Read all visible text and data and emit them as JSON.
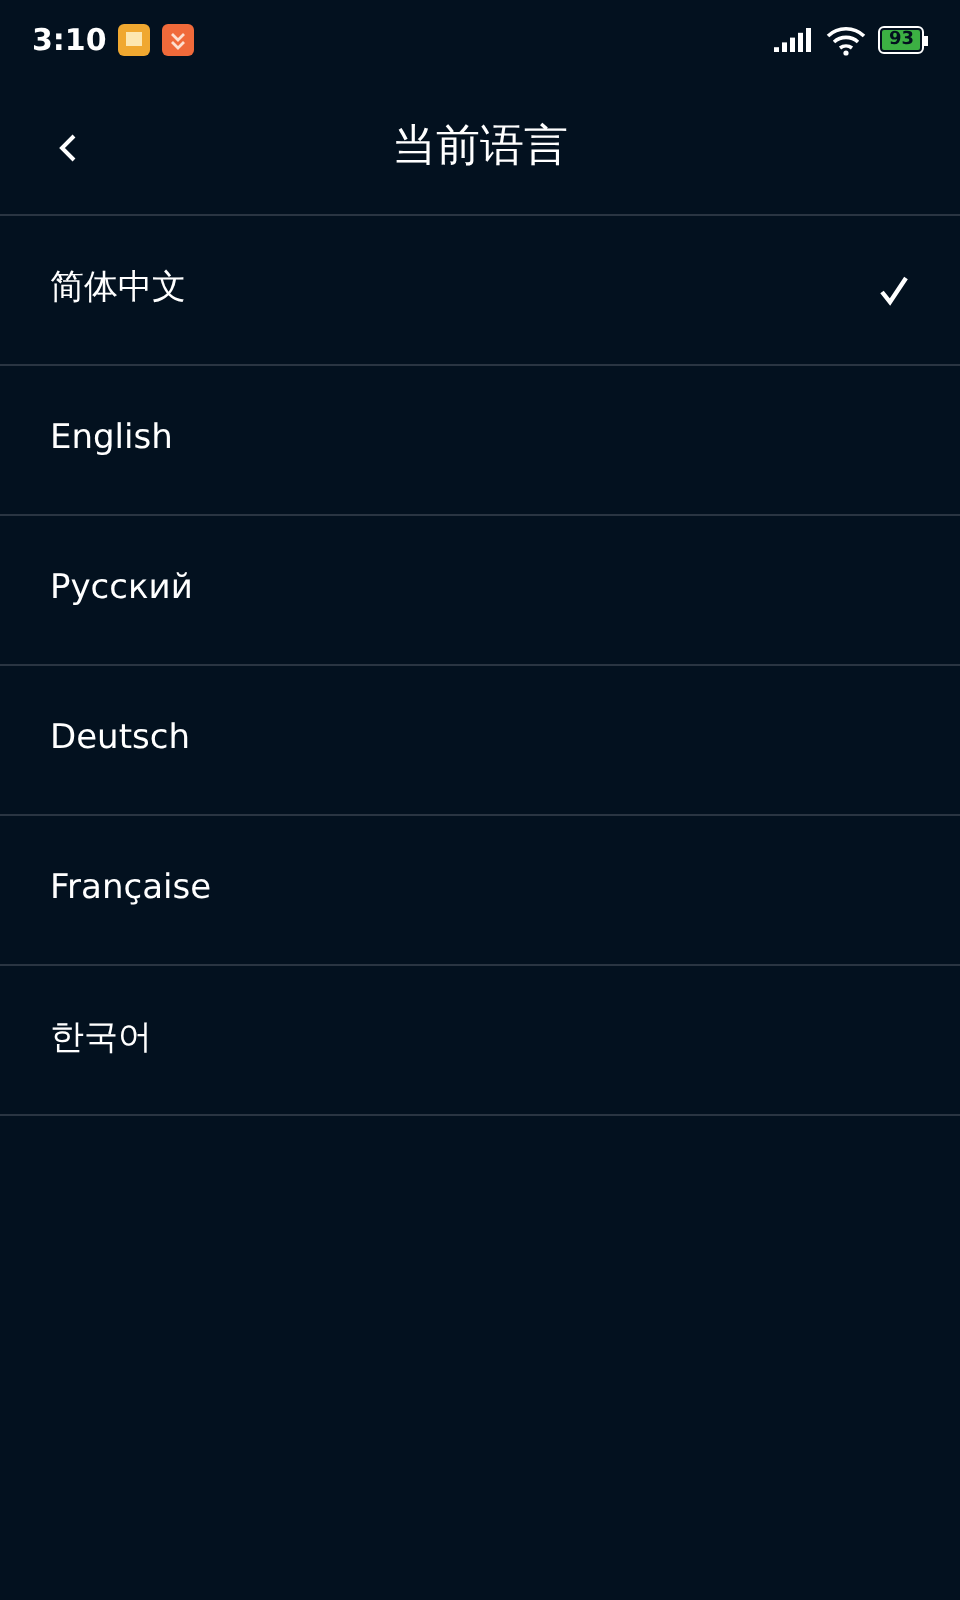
{
  "status_bar": {
    "time": "3:10",
    "battery": "93"
  },
  "header": {
    "title": "当前语言"
  },
  "languages": [
    {
      "label": "简体中文",
      "selected": true
    },
    {
      "label": "English",
      "selected": false
    },
    {
      "label": "Русский",
      "selected": false
    },
    {
      "label": "Deutsch",
      "selected": false
    },
    {
      "label": "Française",
      "selected": false
    },
    {
      "label": "한국어",
      "selected": false
    }
  ]
}
